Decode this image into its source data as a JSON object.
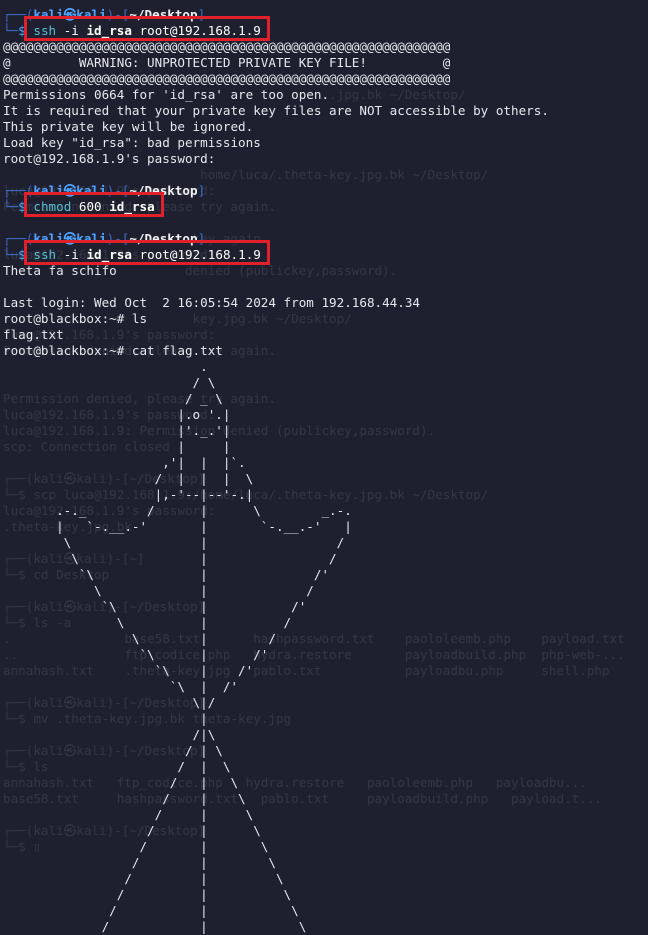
{
  "prompt": {
    "user_host": "kali㉿kali",
    "dir": "~/Desktop",
    "dollar": "$"
  },
  "session": [
    {
      "kind": "prompt"
    },
    {
      "kind": "cmd",
      "name": "ssh",
      "flag": "-i",
      "key": "id_rsa",
      "target": "root@192.168.1.9"
    },
    {
      "kind": "out",
      "text": "@@@@@@@@@@@@@@@@@@@@@@@@@@@@@@@@@@@@@@@@@@@@@@@@@@@@@@@@@@@"
    },
    {
      "kind": "out",
      "text": "@         WARNING: UNPROTECTED PRIVATE KEY FILE!          @"
    },
    {
      "kind": "out",
      "text": "@@@@@@@@@@@@@@@@@@@@@@@@@@@@@@@@@@@@@@@@@@@@@@@@@@@@@@@@@@@"
    },
    {
      "kind": "out",
      "text": "Permissions 0664 for 'id_rsa' are too open."
    },
    {
      "kind": "out",
      "text": "It is required that your private key files are NOT accessible by others."
    },
    {
      "kind": "out",
      "text": "This private key will be ignored."
    },
    {
      "kind": "out",
      "text": "Load key \"id_rsa\": bad permissions"
    },
    {
      "kind": "out",
      "text": "root@192.168.1.9's password:"
    },
    {
      "kind": "blank"
    },
    {
      "kind": "prompt"
    },
    {
      "kind": "cmd",
      "name": "chmod",
      "flag": "600",
      "key": "id_rsa",
      "target": ""
    },
    {
      "kind": "blank"
    },
    {
      "kind": "prompt"
    },
    {
      "kind": "cmd",
      "name": "ssh",
      "flag": "-i",
      "key": "id_rsa",
      "target": "root@192.168.1.9"
    },
    {
      "kind": "out",
      "text": "Theta fa schifo"
    },
    {
      "kind": "blank"
    },
    {
      "kind": "out",
      "text": "Last login: Wed Oct  2 16:05:54 2024 from 192.168.44.34"
    },
    {
      "kind": "out",
      "text": "root@blackbox:~# ls"
    },
    {
      "kind": "out",
      "text": "flag.txt"
    },
    {
      "kind": "out",
      "text": "root@blackbox:~# cat flag.txt"
    },
    {
      "kind": "out",
      "text": "                          ."
    },
    {
      "kind": "out",
      "text": "                         / \\"
    },
    {
      "kind": "out",
      "text": "                        / _ \\"
    },
    {
      "kind": "out",
      "text": "                       |.o '.|"
    },
    {
      "kind": "out",
      "text": "                       |'._.'|"
    },
    {
      "kind": "out",
      "text": "                       |     |"
    },
    {
      "kind": "out",
      "text": "                     ,'|  |  |`."
    },
    {
      "kind": "out",
      "text": "                    /  |  |  |  \\"
    },
    {
      "kind": "out",
      "text": "                    |,-'--|--'-.|"
    },
    {
      "kind": "out",
      "text": "       .-._        /      |      \\        _.-."
    },
    {
      "kind": "out",
      "text": "       |   `-.__.-'       |       `-.__.-'   |"
    },
    {
      "kind": "out",
      "text": "        \\                 |                 /"
    },
    {
      "kind": "out",
      "text": "         \\                |                /"
    },
    {
      "kind": "out",
      "text": "          `\\              |              /'"
    },
    {
      "kind": "out",
      "text": "            \\             |             /"
    },
    {
      "kind": "out",
      "text": "             `\\           |           /'"
    },
    {
      "kind": "out",
      "text": "               \\          |          /"
    },
    {
      "kind": "out",
      "text": "                 \\        |        /"
    },
    {
      "kind": "out",
      "text": "                  `\\      |      /'"
    },
    {
      "kind": "out",
      "text": "                    `\\    |    /'"
    },
    {
      "kind": "out",
      "text": "                      `\\  |  /'"
    },
    {
      "kind": "out",
      "text": "                         \\|/"
    },
    {
      "kind": "out",
      "text": "                          |"
    },
    {
      "kind": "out",
      "text": "                         /|\\"
    },
    {
      "kind": "out",
      "text": "                        / | \\"
    },
    {
      "kind": "out",
      "text": "                       /  |  \\"
    },
    {
      "kind": "out",
      "text": "                      /   |   \\"
    },
    {
      "kind": "out",
      "text": "                     /    |    \\"
    },
    {
      "kind": "out",
      "text": "                    /     |     \\"
    },
    {
      "kind": "out",
      "text": "                   /      |      \\"
    },
    {
      "kind": "out",
      "text": "                  /       |       \\"
    },
    {
      "kind": "out",
      "text": "                 /        |        \\"
    },
    {
      "kind": "out",
      "text": "                /         |         \\"
    },
    {
      "kind": "out",
      "text": "               /          |          \\"
    },
    {
      "kind": "out",
      "text": "              /           |           \\"
    },
    {
      "kind": "out",
      "text": "             /            |            \\"
    }
  ],
  "background_history": [
    {
      "line": 5,
      "text": "                                           .jpg.bk ~/Desktop/"
    },
    {
      "line": 10,
      "text": "                          home/luca/.theta-key.jpg.bk ~/Desktop/"
    },
    {
      "line": 11,
      "text": "luca@192.168.1.9's password:"
    },
    {
      "line": 12,
      "text": "Permission denied, please try again."
    },
    {
      "line": 14,
      "text": "                         key again."
    },
    {
      "line": 15,
      "text": "luca@192.168.1.9's password:"
    },
    {
      "line": 16,
      "text": "                        denied (publickey,password)."
    },
    {
      "line": 19,
      "text": "                         key.jpg.bk ~/Desktop/"
    },
    {
      "line": 20,
      "text": "luca@192.168.1.9's password:"
    },
    {
      "line": 21,
      "text": "Permission denied, please try again."
    },
    {
      "line": 24,
      "text": "Permission denied, please try again."
    },
    {
      "line": 25,
      "text": "luca@192.168.1.9's password:"
    },
    {
      "line": 26,
      "text": "luca@192.168.1.9: Permission denied (publickey,password)."
    },
    {
      "line": 27,
      "text": "scp: Connection closed"
    },
    {
      "line": 29,
      "text": "┌──(kali㉿kali)-[~/Desktop]"
    },
    {
      "line": 30,
      "text": "└─$ scp luca@192.168.1.9:/home/luca/.theta-key.jpg.bk ~/Desktop/"
    },
    {
      "line": 31,
      "text": "luca@192.168.1.9's password:"
    },
    {
      "line": 32,
      "text": ".theta-key.jpg.bk"
    },
    {
      "line": 34,
      "text": "┌──(kali㉿kali)-[~]"
    },
    {
      "line": 35,
      "text": "└─$ cd Desktop"
    },
    {
      "line": 37,
      "text": "┌──(kali㉿kali)-[~/Desktop]"
    },
    {
      "line": 38,
      "text": "└─$ ls -a"
    },
    {
      "line": 39,
      "text": ".               base58.txt       hashpassword.txt    paololeemb.php    payload.txt"
    },
    {
      "line": 40,
      "text": "..              ftp_codice.php   hydra.restore       payloadbuild.php  php-web-..."
    },
    {
      "line": 41,
      "text": "annahash.txt    .theta-key.jpg   pablo.txt           payloadbu.php     shell.php"
    },
    {
      "line": 43,
      "text": "┌──(kali㉿kali)-[~/Desktop]"
    },
    {
      "line": 44,
      "text": "└─$ mv .theta-key.jpg.bk theta-key.jpg"
    },
    {
      "line": 46,
      "text": "┌──(kali㉿kali)-[~/Desktop]"
    },
    {
      "line": 47,
      "text": "└─$ ls"
    },
    {
      "line": 48,
      "text": "annahash.txt   ftp_codice.php   hydra.restore   paololeemb.php   payloadbu..."
    },
    {
      "line": 49,
      "text": "base58.txt     hashpassword.txt   pablo.txt     payloadbuild.php   payload.t..."
    },
    {
      "line": 51,
      "text": "┌──(kali㉿kali)-[~/Desktop]"
    },
    {
      "line": 52,
      "text": "└─$ ▯"
    }
  ],
  "highlights": [
    {
      "target": "cmd-ssh-1"
    },
    {
      "target": "cmd-chmod"
    },
    {
      "target": "cmd-ssh-2"
    }
  ],
  "colors": {
    "background": "#1e2030",
    "prompt_blue": "#4ea3ff",
    "command_cyan": "#52c0d6",
    "text": "#e7e8ee",
    "highlight_red": "#e0202a"
  }
}
